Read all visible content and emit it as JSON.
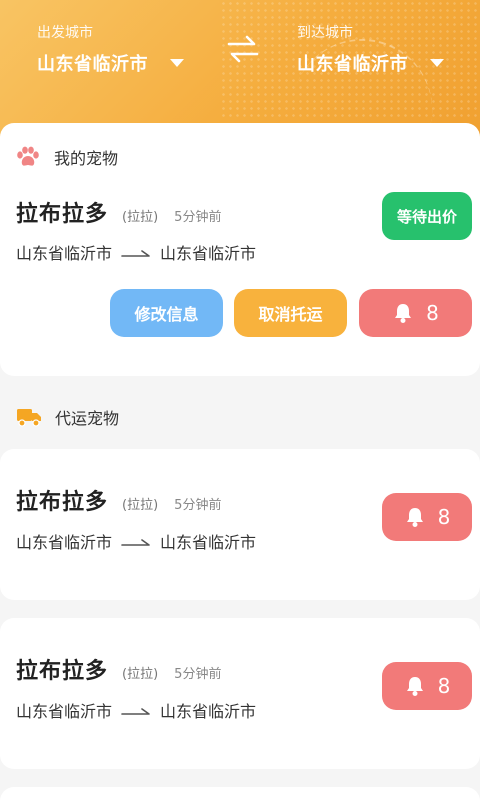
{
  "header": {
    "from_label": "出发城市",
    "from_city": "山东省临沂市",
    "to_label": "到达城市",
    "to_city": "山东省临沂市"
  },
  "my_pets": {
    "section_title": "我的宠物",
    "item": {
      "name": "拉布拉多",
      "breed": "(拉拉)",
      "time": "5分钟前",
      "from": "山东省临沂市",
      "to": "山东省临沂市",
      "status": "等待出价",
      "edit_label": "修改信息",
      "cancel_label": "取消托运",
      "notify_count": "8"
    }
  },
  "shipping": {
    "section_title": "代运宠物",
    "items": [
      {
        "name": "拉布拉多",
        "breed": "(拉拉)",
        "time": "5分钟前",
        "from": "山东省临沂市",
        "to": "山东省临沂市",
        "notify_count": "8"
      },
      {
        "name": "拉布拉多",
        "breed": "(拉拉)",
        "time": "5分钟前",
        "from": "山东省临沂市",
        "to": "山东省临沂市",
        "notify_count": "8"
      }
    ]
  },
  "colors": {
    "header_orange": "#f5ad3e",
    "status_green": "#27c16d",
    "edit_blue": "#72b8f6",
    "cancel_orange": "#f8b23d",
    "bell_red": "#f27a79",
    "paw_pink": "#f08585",
    "truck_orange": "#f5a623"
  }
}
